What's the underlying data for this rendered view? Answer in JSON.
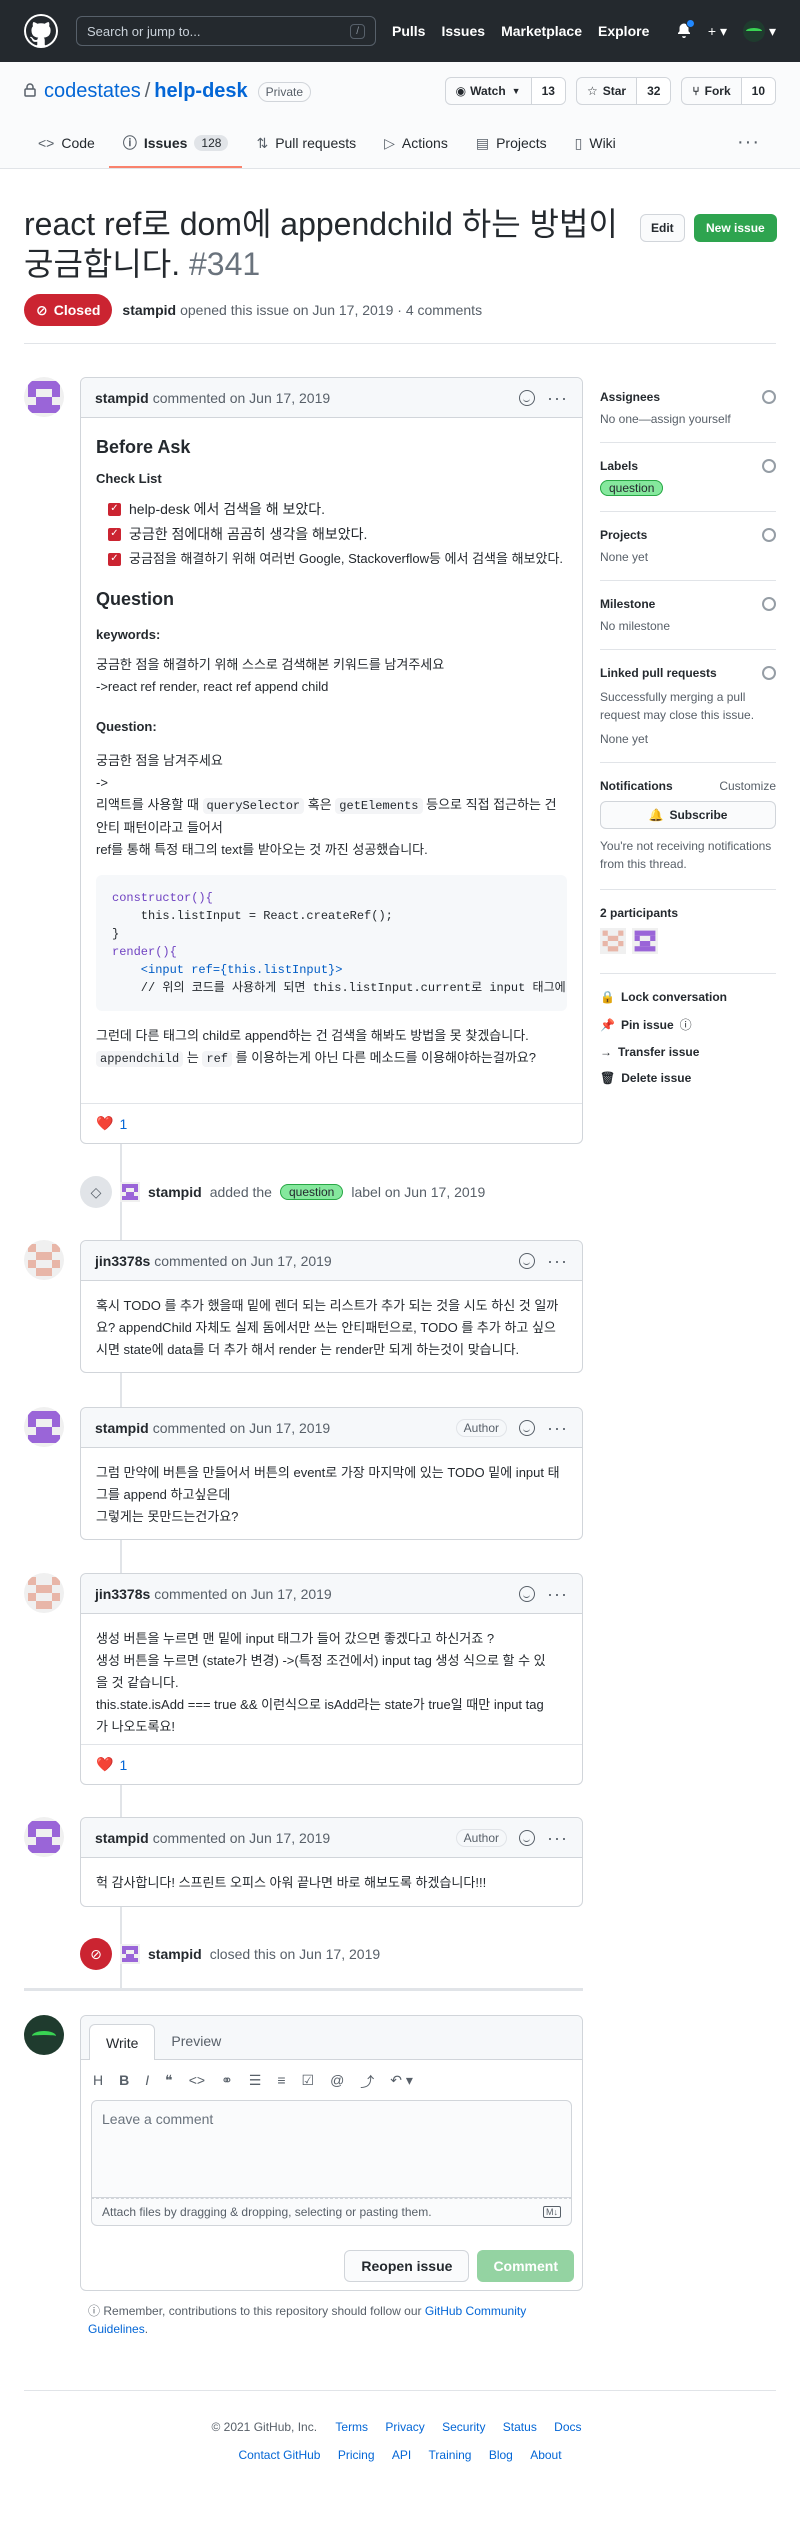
{
  "header": {
    "search_placeholder": "Search or jump to...",
    "search_shortcut": "/",
    "nav": [
      "Pulls",
      "Issues",
      "Marketplace",
      "Explore"
    ]
  },
  "repo": {
    "owner": "codestates",
    "separator": "/",
    "name": "help-desk",
    "visibility": "Private",
    "watch_label": "Watch",
    "watch_count": "13",
    "star_label": "Star",
    "star_count": "32",
    "fork_label": "Fork",
    "fork_count": "10",
    "tabs": [
      {
        "label": "Code"
      },
      {
        "label": "Issues",
        "count": "128"
      },
      {
        "label": "Pull requests"
      },
      {
        "label": "Actions"
      },
      {
        "label": "Projects"
      },
      {
        "label": "Wiki"
      }
    ]
  },
  "issue": {
    "title": "react ref로 dom에 appendchild 하는 방법이 궁금합니다.",
    "number": "#341",
    "edit_label": "Edit",
    "new_label": "New issue",
    "state": "Closed",
    "author": "stampid",
    "meta_text": "opened this issue on Jun 17, 2019 · 4 comments"
  },
  "first_comment": {
    "author": "stampid",
    "meta": "commented on Jun 17, 2019",
    "h_before": "Before Ask",
    "h_checklist": "Check List",
    "checklist": [
      "help-desk 에서 검색을 해 보았다.",
      "궁금한 점에대해 곰곰히 생각을 해보았다.",
      "궁금점을 해결하기 위해 여러번 Google, Stackoverflow등 에서 검색을 해보았다."
    ],
    "h_question": "Question",
    "h_keywords": "keywords:",
    "keywords_1": "궁금한 점을 해결하기 위해 스스로 검색해본 키워드를 남겨주세요",
    "keywords_2": "->react ref render, react ref append child",
    "h_question2": "Question:",
    "q_1": "궁금한 점을 남겨주세요",
    "q_2": "->",
    "q_3a": "리액트를 사용할 때 ",
    "q_3_code1": "querySelector",
    "q_3b": " 혹은 ",
    "q_3_code2": "getElements",
    "q_3c": " 등으로 직접 접근하는 건 안티 패턴이라고 들어서",
    "q_4": "ref를 통해 특정 태그의 text를 받아오는 것 까진 성공했습니다.",
    "code_lines": [
      "constructor(){",
      "    this.listInput = React.createRef();",
      "}",
      "render(){",
      "    <input ref={this.listInput}>",
      "    // 위의 코드를 사용하게 되면 this.listInput.current로 input 태그에 접근"
    ],
    "after_1": "그런데 다른 태그의 child로 append하는 건 검색을 해봐도 방법을 못 찾겠습니다.",
    "after_code1": "appendchild",
    "after_2a": " 는 ",
    "after_code2": "ref",
    "after_2b": " 를 이용하는게 아닌 다른 메소드를 이용해야하는걸까요?",
    "reaction_emoji": "❤️",
    "reaction_count": "1"
  },
  "label_event": {
    "actor": "stampid",
    "pre": "added the",
    "label": "question",
    "post": "label on Jun 17, 2019"
  },
  "comments": [
    {
      "author": "jin3378s",
      "meta": "commented on Jun 17, 2019",
      "lines": [
        "혹시 TODO 를 추가 했을때 밑에 렌더 되는 리스트가 추가 되는 것을 시도 하신 것 일까",
        "요? appendChild 자체도 실제 돔에서만 쓰는 안티패턴으로, TODO 를 추가 하고 싶으",
        "시면 state에 data를 더 추가 해서 render 는 render만 되게 하는것이 맞습니다."
      ]
    },
    {
      "author": "stampid",
      "meta": "commented on Jun 17, 2019",
      "badge": "Author",
      "lines": [
        "그럼 만약에 버튼을 만들어서 버튼의 event로 가장 마지막에 있는 TODO 밑에 input 태",
        "그를 append 하고싶은데",
        "그렇게는 못만드는건가요?"
      ]
    },
    {
      "author": "jin3378s",
      "meta": "commented on Jun 17, 2019",
      "lines": [
        "생성 버튼을 누르면 맨 밑에 input 태그가 들어 갔으면 좋겠다고 하신거죠 ?",
        "생성 버튼을 누르면 (state가 변경) ->(특정 조건에서) input tag 생성 식으로 할 수 있",
        "을 것 같습니다.",
        "this.state.isAdd === true && 이런식으로 isAdd라는 state가 true일 때만 input tag",
        "가 나오도록요!"
      ],
      "reaction_emoji": "❤️",
      "reaction_count": "1"
    },
    {
      "author": "stampid",
      "meta": "commented on Jun 17, 2019",
      "badge": "Author",
      "lines": [
        "헉 감사합니다! 스프린트 오피스 아워 끝나면 바로 해보도록 하겠습니다!!!"
      ]
    }
  ],
  "close_event": {
    "actor": "stampid",
    "text": "closed this on Jun 17, 2019"
  },
  "sidebar": {
    "assignees_h": "Assignees",
    "assignees_v": "No one—assign yourself",
    "labels_h": "Labels",
    "labels_v": "question",
    "projects_h": "Projects",
    "projects_v": "None yet",
    "milestone_h": "Milestone",
    "milestone_v": "No milestone",
    "linked_h": "Linked pull requests",
    "linked_v1": "Successfully merging a pull request may close this issue.",
    "linked_v2": "None yet",
    "notif_h": "Notifications",
    "notif_custom": "Customize",
    "subscribe": "Subscribe",
    "notif_text": "You're not receiving notifications from this thread.",
    "participants_h": "2 participants",
    "lock": "Lock conversation",
    "pin": "Pin issue",
    "transfer": "Transfer issue",
    "delete": "Delete issue"
  },
  "composer": {
    "tab_write": "Write",
    "tab_preview": "Preview",
    "placeholder": "Leave a comment",
    "attach": "Attach files by dragging & dropping, selecting or pasting them.",
    "reopen": "Reopen issue",
    "comment": "Comment",
    "remember_pre": "Remember, contributions to this repository should follow our ",
    "remember_link": "GitHub Community Guidelines",
    "remember_post": "."
  },
  "footer": {
    "copyright": "© 2021 GitHub, Inc.",
    "row1": [
      "Terms",
      "Privacy",
      "Security",
      "Status",
      "Docs"
    ],
    "row2": [
      "Contact GitHub",
      "Pricing",
      "API",
      "Training",
      "Blog",
      "About"
    ]
  },
  "colors": {
    "header_bg": "#24292e",
    "closed_red": "#cb2431",
    "new_issue_green": "#2ea44f",
    "link_blue": "#0366d6",
    "tab_underline": "#f9826c"
  }
}
